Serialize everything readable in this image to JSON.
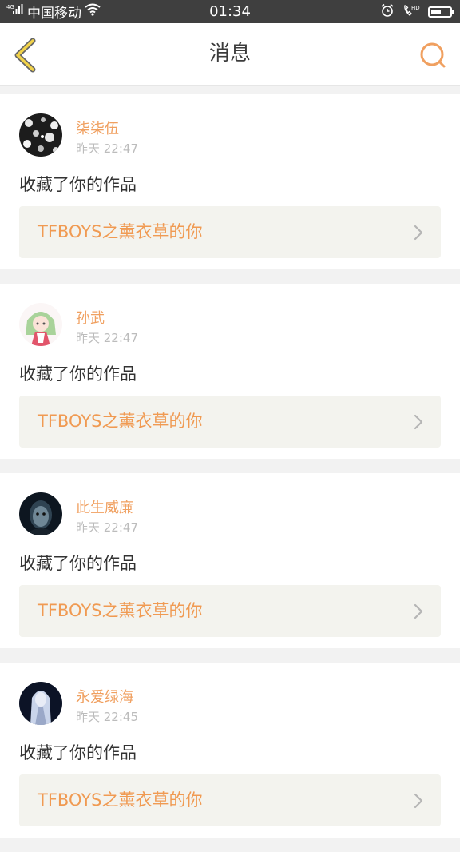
{
  "status_bar": {
    "carrier": "中国移动",
    "network": "4G",
    "time": "01:34",
    "battery_level": 0.55
  },
  "nav": {
    "title": "消息",
    "back_icon": "chevron-left-icon",
    "search_icon": "search-icon",
    "accent_color": "#f0a060"
  },
  "messages": [
    {
      "user": "柒柒伍",
      "time": "昨天 22:47",
      "action": "收藏了你的作品",
      "work": "TFBOYS之薰衣草的你"
    },
    {
      "user": "孙武",
      "time": "昨天 22:47",
      "action": "收藏了你的作品",
      "work": "TFBOYS之薰衣草的你"
    },
    {
      "user": "此生威廉",
      "time": "昨天 22:47",
      "action": "收藏了你的作品",
      "work": "TFBOYS之薰衣草的你"
    },
    {
      "user": "永爱绿海",
      "time": "昨天 22:45",
      "action": "收藏了你的作品",
      "work": "TFBOYS之薰衣草的你"
    }
  ]
}
